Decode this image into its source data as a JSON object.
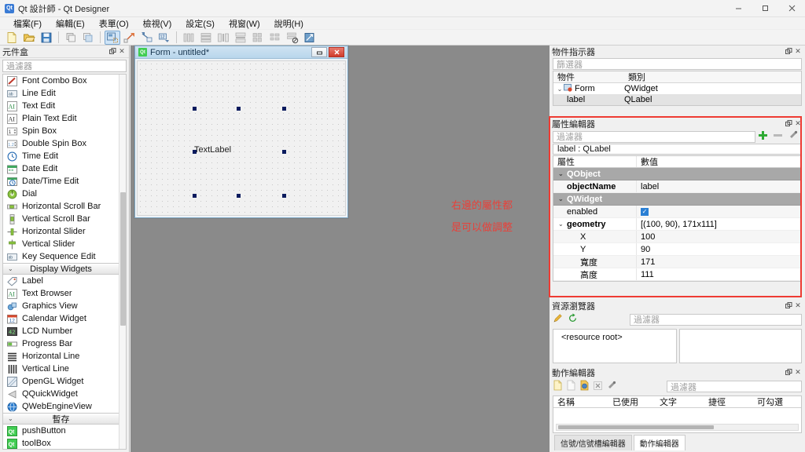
{
  "window": {
    "title": "Qt 設計師 - Qt Designer",
    "app_icon": "qt-icon",
    "minimize": "minimize-icon",
    "maximize": "maximize-icon",
    "close": "close-icon"
  },
  "menubar": [
    {
      "label": "檔案(F)"
    },
    {
      "label": "編輯(E)"
    },
    {
      "label": "表單(O)"
    },
    {
      "label": "檢視(V)"
    },
    {
      "label": "設定(S)"
    },
    {
      "label": "視窗(W)"
    },
    {
      "label": "說明(H)"
    }
  ],
  "toolbar": [
    {
      "name": "new-form-icon",
      "active": false
    },
    {
      "name": "open-form-icon",
      "active": false
    },
    {
      "name": "save-form-icon",
      "active": false
    },
    {
      "name": "separator"
    },
    {
      "name": "undo-icon",
      "active": false
    },
    {
      "name": "redo-icon",
      "active": false
    },
    {
      "name": "separator"
    },
    {
      "name": "edit-widgets-icon",
      "active": true
    },
    {
      "name": "edit-signals-slots-icon",
      "active": false
    },
    {
      "name": "edit-buddies-icon",
      "active": false
    },
    {
      "name": "edit-tab-order-icon",
      "active": false
    },
    {
      "name": "separator"
    },
    {
      "name": "layout-horizontally-icon",
      "active": false
    },
    {
      "name": "layout-vertically-icon",
      "active": false
    },
    {
      "name": "layout-splitter-horizontal-icon",
      "active": false
    },
    {
      "name": "layout-splitter-vertical-icon",
      "active": false
    },
    {
      "name": "layout-grid-icon",
      "active": false
    },
    {
      "name": "layout-form-icon",
      "active": false
    },
    {
      "name": "break-layout-icon",
      "active": false
    },
    {
      "name": "adjust-size-icon",
      "active": false
    }
  ],
  "widget_box": {
    "title": "元件盒",
    "filter_placeholder": "過濾器",
    "float_icon": "float-icon",
    "close_icon": "close-icon",
    "items": [
      {
        "type": "item",
        "label": "Font Combo Box",
        "icon": "font-combo-box-icon"
      },
      {
        "type": "item",
        "label": "Line Edit",
        "icon": "line-edit-icon"
      },
      {
        "type": "item",
        "label": "Text Edit",
        "icon": "text-edit-icon"
      },
      {
        "type": "item",
        "label": "Plain Text Edit",
        "icon": "plain-text-edit-icon"
      },
      {
        "type": "item",
        "label": "Spin Box",
        "icon": "spin-box-icon"
      },
      {
        "type": "item",
        "label": "Double Spin Box",
        "icon": "double-spin-box-icon"
      },
      {
        "type": "item",
        "label": "Time Edit",
        "icon": "time-edit-icon"
      },
      {
        "type": "item",
        "label": "Date Edit",
        "icon": "date-edit-icon"
      },
      {
        "type": "item",
        "label": "Date/Time Edit",
        "icon": "date-time-edit-icon"
      },
      {
        "type": "item",
        "label": "Dial",
        "icon": "dial-icon"
      },
      {
        "type": "item",
        "label": "Horizontal Scroll Bar",
        "icon": "horizontal-scroll-bar-icon"
      },
      {
        "type": "item",
        "label": "Vertical Scroll Bar",
        "icon": "vertical-scroll-bar-icon"
      },
      {
        "type": "item",
        "label": "Horizontal Slider",
        "icon": "horizontal-slider-icon"
      },
      {
        "type": "item",
        "label": "Vertical Slider",
        "icon": "vertical-slider-icon"
      },
      {
        "type": "item",
        "label": "Key Sequence Edit",
        "icon": "key-sequence-edit-icon"
      },
      {
        "type": "section",
        "label": "Display Widgets"
      },
      {
        "type": "item",
        "label": "Label",
        "icon": "label-icon"
      },
      {
        "type": "item",
        "label": "Text Browser",
        "icon": "text-browser-icon"
      },
      {
        "type": "item",
        "label": "Graphics View",
        "icon": "graphics-view-icon"
      },
      {
        "type": "item",
        "label": "Calendar Widget",
        "icon": "calendar-widget-icon"
      },
      {
        "type": "item",
        "label": "LCD Number",
        "icon": "lcd-number-icon"
      },
      {
        "type": "item",
        "label": "Progress Bar",
        "icon": "progress-bar-icon"
      },
      {
        "type": "item",
        "label": "Horizontal Line",
        "icon": "horizontal-line-icon"
      },
      {
        "type": "item",
        "label": "Vertical Line",
        "icon": "vertical-line-icon"
      },
      {
        "type": "item",
        "label": "OpenGL Widget",
        "icon": "opengl-widget-icon"
      },
      {
        "type": "item",
        "label": "QQuickWidget",
        "icon": "qquickwidget-icon"
      },
      {
        "type": "item",
        "label": "QWebEngineView",
        "icon": "qwebengineview-icon"
      },
      {
        "type": "section",
        "label": "暫存"
      },
      {
        "type": "item",
        "label": "pushButton",
        "icon": "qt-scratch-icon"
      },
      {
        "type": "item",
        "label": "toolBox",
        "icon": "qt-scratch-icon"
      }
    ]
  },
  "form": {
    "title": "Form - untitled*",
    "icon": "qt-form-icon",
    "minimize_label": "–",
    "close_label": "✕",
    "selected_widget_text": "TextLabel"
  },
  "annotation": {
    "line1": "右邊的屬性都",
    "line2": "是可以做調整",
    "color": "#ee3b33"
  },
  "object_inspector": {
    "title": "物件指示器",
    "filter_placeholder": "篩選器",
    "columns": [
      "物件",
      "類別"
    ],
    "rows": [
      {
        "object": "Form",
        "class": "QWidget",
        "indent": 0,
        "expanded": true,
        "selected": false,
        "icon": "form-widget-icon"
      },
      {
        "object": "label",
        "class": "QLabel",
        "indent": 1,
        "expanded": false,
        "selected": true,
        "icon": ""
      }
    ]
  },
  "property_editor": {
    "title": "屬性編輯器",
    "filter_placeholder": "過濾器",
    "add_icon": "plus-icon",
    "remove_icon": "minus-icon",
    "configure_icon": "wrench-icon",
    "selected_object": "label : QLabel",
    "columns": [
      "屬性",
      "數值"
    ],
    "rows": [
      {
        "kind": "group",
        "name": "QObject",
        "value": ""
      },
      {
        "kind": "prop",
        "name": "objectName",
        "value": "label",
        "bold": true,
        "indent": 1
      },
      {
        "kind": "group",
        "name": "QWidget",
        "value": ""
      },
      {
        "kind": "prop",
        "name": "enabled",
        "value": "",
        "checkbox": true,
        "indent": 1
      },
      {
        "kind": "prop",
        "name": "geometry",
        "value": "[(100, 90), 171x111]",
        "bold": true,
        "expandable": true,
        "indent": 0
      },
      {
        "kind": "prop",
        "name": "X",
        "value": "100",
        "indent": 2
      },
      {
        "kind": "prop",
        "name": "Y",
        "value": "90",
        "indent": 2
      },
      {
        "kind": "prop",
        "name": "寬度",
        "value": "171",
        "indent": 2
      },
      {
        "kind": "prop",
        "name": "高度",
        "value": "111",
        "indent": 2
      }
    ]
  },
  "resource_browser": {
    "title": "資源瀏覽器",
    "edit_icon": "pencil-icon",
    "reload_icon": "reload-icon",
    "filter_placeholder": "過濾器",
    "root_label": "<resource root>"
  },
  "action_editor": {
    "title": "動作編輯器",
    "filter_placeholder": "過濾器",
    "tools": [
      {
        "name": "new-action-icon"
      },
      {
        "name": "copy-action-icon"
      },
      {
        "name": "paste-action-icon"
      },
      {
        "name": "delete-action-icon"
      },
      {
        "name": "edit-action-icon"
      }
    ],
    "columns": [
      "名稱",
      "已使用",
      "文字",
      "捷徑",
      "可勾選"
    ],
    "rows": [],
    "tabs": [
      {
        "label": "信號/信號槽編輯器",
        "active": false
      },
      {
        "label": "動作編輯器",
        "active": true
      }
    ]
  }
}
